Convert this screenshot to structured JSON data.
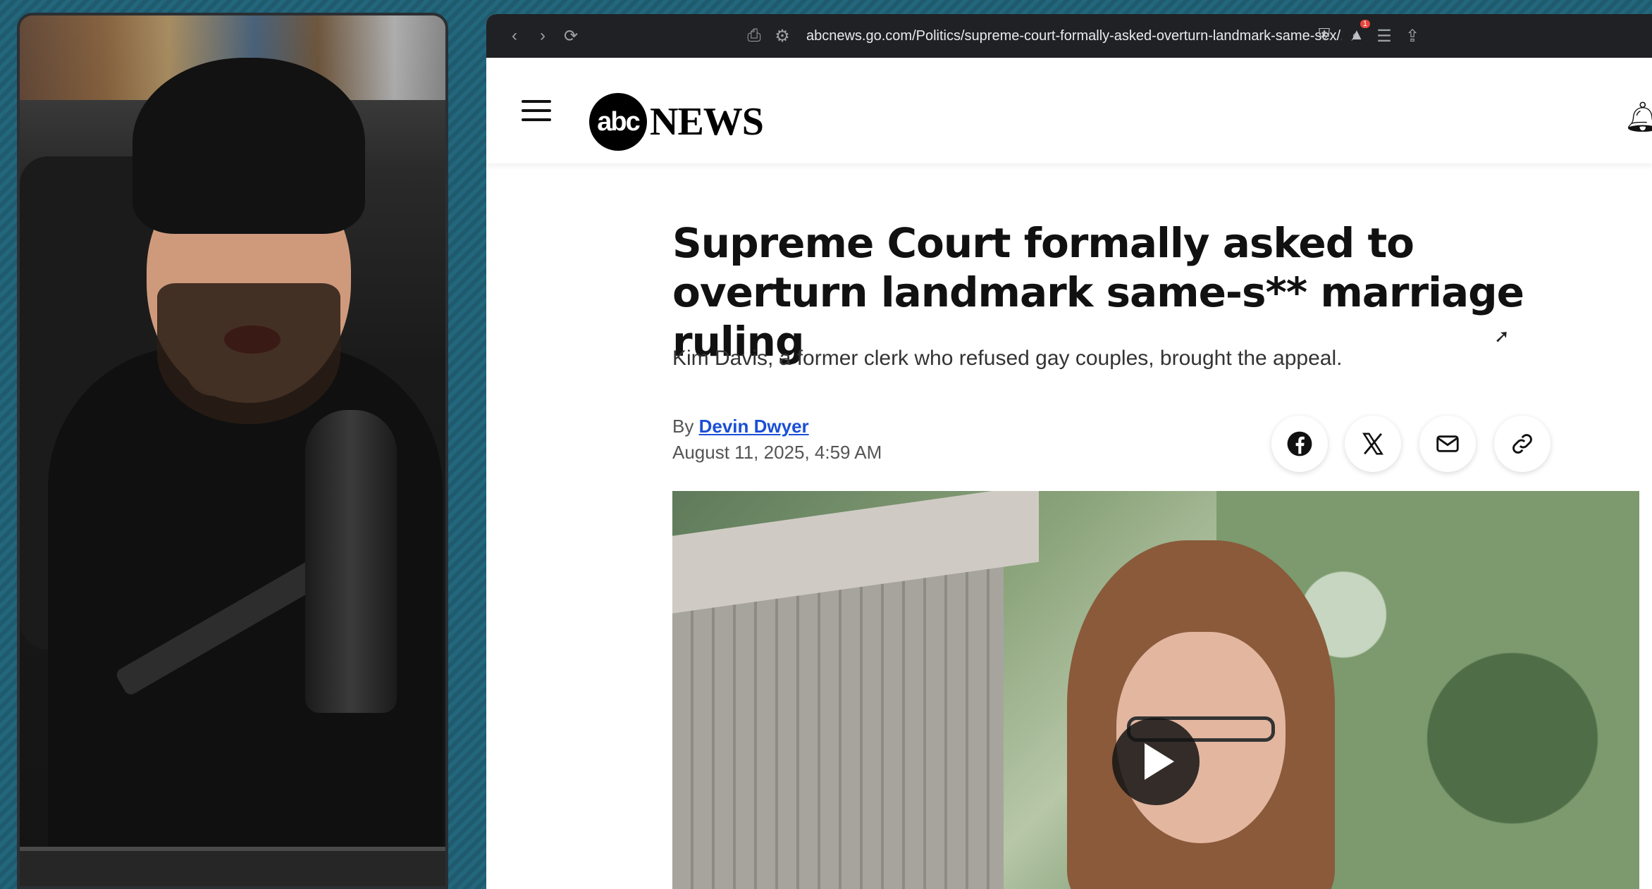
{
  "browser": {
    "url": "abcnews.go.com/Politics/supreme-court-formally-asked-overturn-landmark-same-sex/...",
    "extension_badge": "1"
  },
  "site": {
    "logo_circle": "abc",
    "logo_text": "NEWS"
  },
  "article": {
    "headline": "Supreme Court formally asked to overturn landmark same-s** marriage ruling",
    "subhead": "Kim Davis, a former clerk who refused gay couples, brought the appeal.",
    "by_prefix": "By",
    "author": "Devin Dwyer",
    "date": "August 11, 2025, 4:59 AM"
  },
  "share_icons": [
    "facebook-icon",
    "x-icon",
    "email-icon",
    "link-icon"
  ],
  "colors": {
    "author_link": "#1a4fd6",
    "toolbar": "#202124",
    "badge": "#e8453c"
  }
}
